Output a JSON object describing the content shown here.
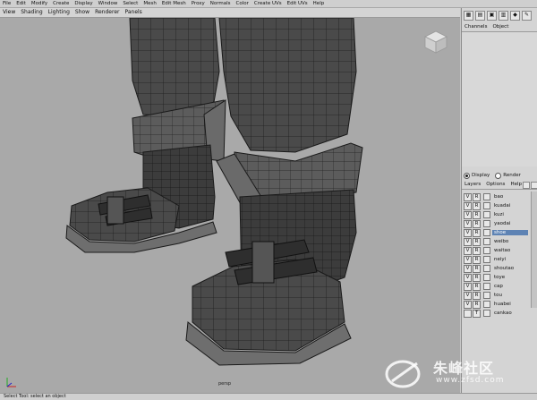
{
  "menubar": {
    "items": [
      "File",
      "Edit",
      "Modify",
      "Create",
      "Display",
      "Window",
      "Select",
      "Mesh",
      "Edit Mesh",
      "Proxy",
      "Normals",
      "Color",
      "Create UVs",
      "Edit UVs",
      "Help"
    ]
  },
  "panel_menu": {
    "items": [
      "View",
      "Shading",
      "Lighting",
      "Show",
      "Renderer",
      "Panels"
    ]
  },
  "viewport": {
    "camera_label": "persp"
  },
  "channel_box": {
    "tabs": [
      "Channels",
      "Object"
    ]
  },
  "display_render": {
    "display_label": "Display",
    "render_label": "Render",
    "selected": "Display"
  },
  "layer_menu": {
    "items": [
      "Layers",
      "Options",
      "Help"
    ]
  },
  "layers": [
    {
      "v": "V",
      "r": "R",
      "name": "bao",
      "selected": false
    },
    {
      "v": "V",
      "r": "R",
      "name": "kuadai",
      "selected": false
    },
    {
      "v": "V",
      "r": "R",
      "name": "kuzi",
      "selected": false
    },
    {
      "v": "V",
      "r": "R",
      "name": "yaodai",
      "selected": false
    },
    {
      "v": "V",
      "r": "R",
      "name": "shoe",
      "selected": true
    },
    {
      "v": "V",
      "r": "R",
      "name": "weibo",
      "selected": false
    },
    {
      "v": "V",
      "r": "R",
      "name": "waitao",
      "selected": false
    },
    {
      "v": "V",
      "r": "R",
      "name": "neiyi",
      "selected": false
    },
    {
      "v": "V",
      "r": "R",
      "name": "shoutao",
      "selected": false
    },
    {
      "v": "V",
      "r": "R",
      "name": "toye",
      "selected": false
    },
    {
      "v": "V",
      "r": "R",
      "name": "cap",
      "selected": false
    },
    {
      "v": "V",
      "r": "R",
      "name": "tou",
      "selected": false
    },
    {
      "v": "V",
      "r": "R",
      "name": "huabei",
      "selected": false
    },
    {
      "v": "",
      "r": "T",
      "name": "cankao",
      "selected": false
    }
  ],
  "status_bar": {
    "text": "Select Tool: select an object"
  },
  "watermark": {
    "text": "朱峰社区",
    "url": "www.zfsd.com"
  },
  "colors": {
    "selection": "#5e83b4",
    "viewport_bg": "#a9a9a9",
    "mesh_dark": "#3d3d3d",
    "mesh_mid": "#5a5a5a",
    "mesh_wire": "#1a1a1a"
  }
}
